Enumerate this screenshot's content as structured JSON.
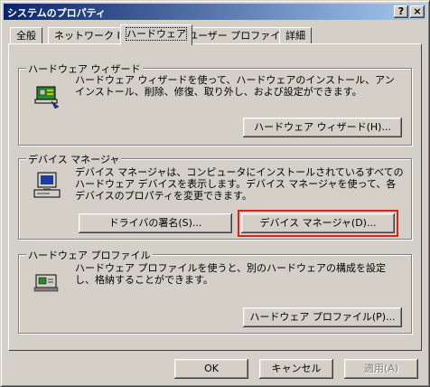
{
  "window": {
    "title": "システムのプロパティ"
  },
  "titlebar_buttons": {
    "help": "?",
    "close": "×"
  },
  "tabs": [
    "全般",
    "ネットワーク ID",
    "ハードウェア",
    "ユーザー プロファイル",
    "詳細"
  ],
  "hardware_wizard": {
    "legend": "ハードウェア ウィザード",
    "description": "ハードウェア ウィザードを使って、ハードウェアのインストール、アンインストール、削除、修復、取り外し、および設定ができます。",
    "button": "ハードウェア ウィザード(H)..."
  },
  "device_manager": {
    "legend": "デバイス マネージャ",
    "description": "デバイス マネージャは、コンピュータにインストールされているすべてのハードウェア デバイスを表示します。デバイス マネージャを使って、各デバイスのプロパティを変更できます。",
    "driver_signing_button": "ドライバの署名(S)...",
    "device_manager_button": "デバイス マネージャ(D)..."
  },
  "hardware_profiles": {
    "legend": "ハードウェア プロファイル",
    "description": "ハードウェア プロファイルを使うと、別のハードウェアの構成を設定し、格納することができます。",
    "button": "ハードウェア プロファイル(P)..."
  },
  "footer": {
    "ok": "OK",
    "cancel": "キャンセル",
    "apply": "適用(A)"
  }
}
